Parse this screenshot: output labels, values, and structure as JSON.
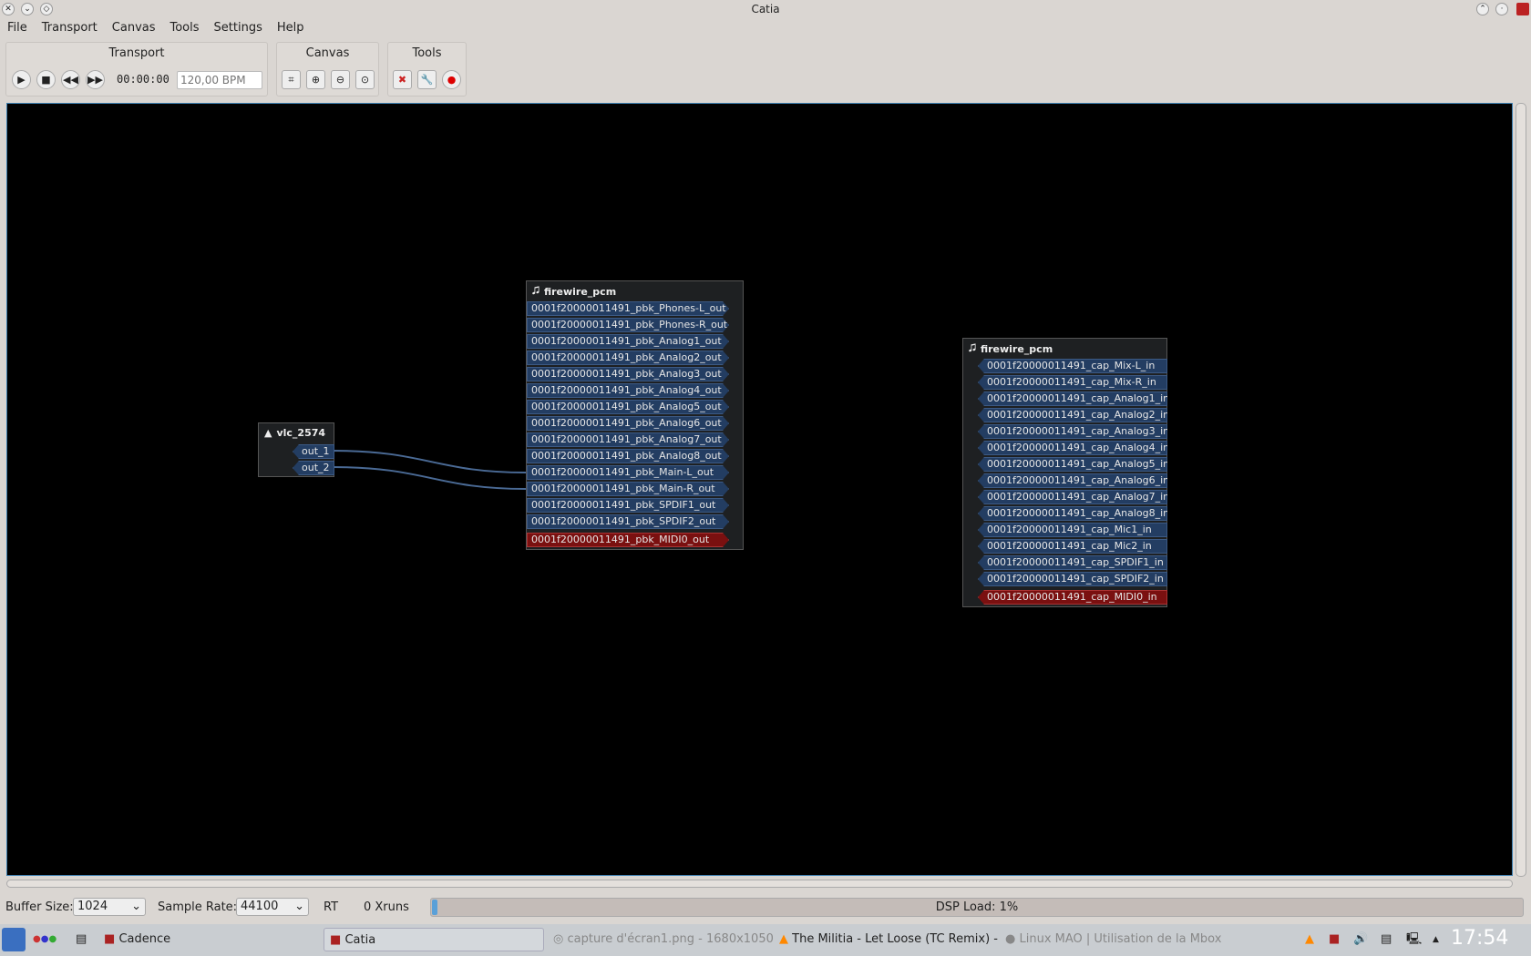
{
  "window": {
    "title": "Catia"
  },
  "menu": [
    "File",
    "Transport",
    "Canvas",
    "Tools",
    "Settings",
    "Help"
  ],
  "toolbar": {
    "transport_label": "Transport",
    "canvas_label": "Canvas",
    "tools_label": "Tools",
    "time": "00:00:00",
    "bpm_placeholder": "120,00 BPM"
  },
  "nodes": {
    "vlc": {
      "title": "vlc_2574",
      "ports": [
        "out_1",
        "out_2"
      ]
    },
    "playback": {
      "title": "firewire_pcm",
      "ports": [
        "0001f20000011491_pbk_Phones-L_out",
        "0001f20000011491_pbk_Phones-R_out",
        "0001f20000011491_pbk_Analog1_out",
        "0001f20000011491_pbk_Analog2_out",
        "0001f20000011491_pbk_Analog3_out",
        "0001f20000011491_pbk_Analog4_out",
        "0001f20000011491_pbk_Analog5_out",
        "0001f20000011491_pbk_Analog6_out",
        "0001f20000011491_pbk_Analog7_out",
        "0001f20000011491_pbk_Analog8_out",
        "0001f20000011491_pbk_Main-L_out",
        "0001f20000011491_pbk_Main-R_out",
        "0001f20000011491_pbk_SPDIF1_out",
        "0001f20000011491_pbk_SPDIF2_out"
      ],
      "midi_port": "0001f20000011491_pbk_MIDI0_out"
    },
    "capture": {
      "title": "firewire_pcm",
      "ports": [
        "0001f20000011491_cap_Mix-L_in",
        "0001f20000011491_cap_Mix-R_in",
        "0001f20000011491_cap_Analog1_in",
        "0001f20000011491_cap_Analog2_in",
        "0001f20000011491_cap_Analog3_in",
        "0001f20000011491_cap_Analog4_in",
        "0001f20000011491_cap_Analog5_in",
        "0001f20000011491_cap_Analog6_in",
        "0001f20000011491_cap_Analog7_in",
        "0001f20000011491_cap_Analog8_in",
        "0001f20000011491_cap_Mic1_in",
        "0001f20000011491_cap_Mic2_in",
        "0001f20000011491_cap_SPDIF1_in",
        "0001f20000011491_cap_SPDIF2_in"
      ],
      "midi_port": "0001f20000011491_cap_MIDI0_in"
    }
  },
  "colors": {
    "audio_port": "#233d62",
    "midi_port": "#7a1010",
    "connection": "#4a6a95"
  },
  "status": {
    "buffer_label": "Buffer Size:",
    "buffer_value": "1024",
    "rate_label": "Sample Rate:",
    "rate_value": "44100",
    "rt": "RT",
    "xruns": "0 Xruns",
    "dsp": "DSP Load: 1%",
    "dsp_percent": 1
  },
  "taskbar": {
    "cadence": "Cadence",
    "catia": "Catia",
    "capture": "capture d'écran1.png - 1680x1050",
    "vlc": "The Militia - Let Loose (TC Remix) -",
    "browser": "Linux MAO | Utilisation de la Mbox",
    "clock": "17:54"
  }
}
